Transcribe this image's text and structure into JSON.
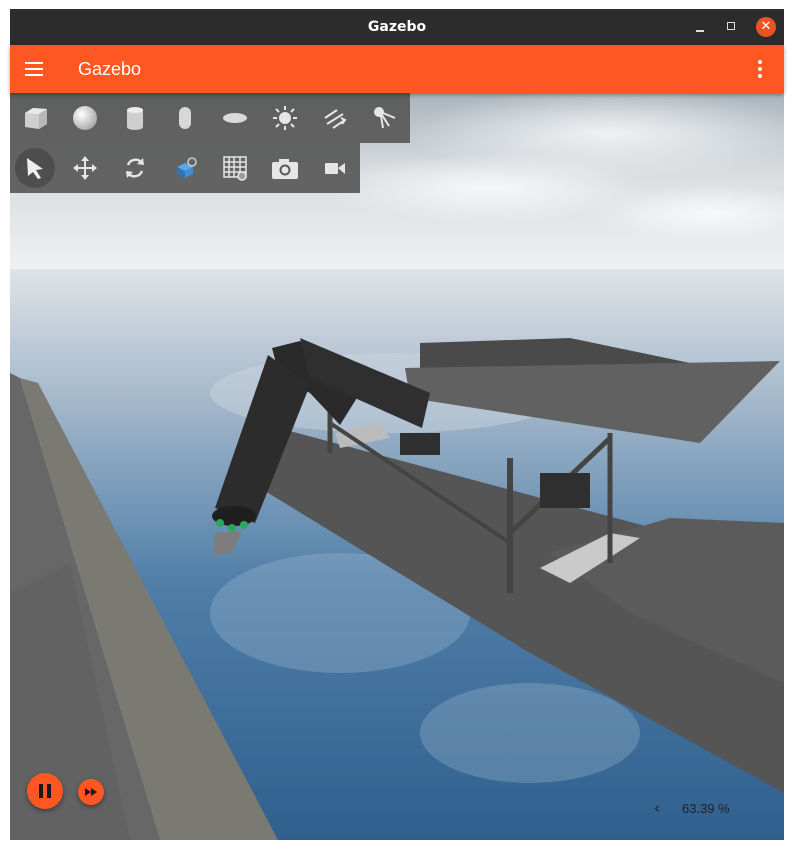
{
  "window": {
    "title": "Gazebo",
    "controls": {
      "close_glyph": "✕"
    }
  },
  "appbar": {
    "title": "Gazebo",
    "menu_icon": "hamburger-menu-icon",
    "overflow_icon": "vertical-dots-icon",
    "color": "#ff5722"
  },
  "toolbars": {
    "shapes": [
      "box-icon",
      "sphere-icon",
      "cylinder-icon",
      "capsule-icon",
      "ellipsoid-icon",
      "point-light-icon",
      "directional-light-icon",
      "spot-light-icon"
    ],
    "transform": [
      "select-arrow-icon",
      "translate-icon",
      "rotate-icon",
      "insert-model-icon",
      "grid-config-icon",
      "screenshot-icon",
      "video-record-icon"
    ],
    "selected_tool": "select-arrow-icon"
  },
  "playback": {
    "state": "playing",
    "play_icon": "pause-icon",
    "step_icon": "fast-forward-icon"
  },
  "stats": {
    "arrow": "‹",
    "real_time_factor": "63.39 %"
  },
  "viewport": {
    "scene": "ocean platform with robotic arm",
    "sky_color": "#c9d3db",
    "water_color": "#3f6f98",
    "platform_color": "#6d6d6d"
  }
}
